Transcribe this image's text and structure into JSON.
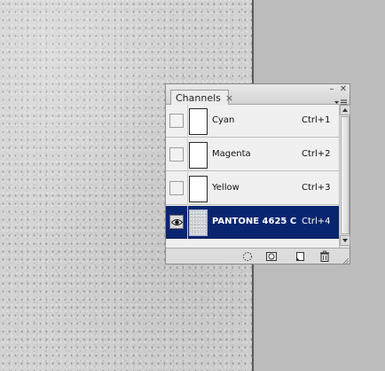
{
  "panel": {
    "tab_label": "Channels",
    "tab_close_glyph": "×",
    "minimize_glyph": "–",
    "close_glyph": "✕"
  },
  "channels": [
    {
      "name": "Cyan",
      "shortcut": "Ctrl+1",
      "visible": false,
      "selected": false
    },
    {
      "name": "Magenta",
      "shortcut": "Ctrl+2",
      "visible": false,
      "selected": false
    },
    {
      "name": "Yellow",
      "shortcut": "Ctrl+3",
      "visible": false,
      "selected": false
    },
    {
      "name": "PANTONE 4625 C",
      "shortcut": "Ctrl+4",
      "visible": true,
      "selected": true
    }
  ],
  "footer_icons": [
    "load-selection-icon",
    "save-selection-icon",
    "new-channel-icon",
    "delete-channel-icon"
  ],
  "colors": {
    "selection": "#0a2570",
    "panel_bg": "#d6d6d6",
    "app_bg": "#bcbcbc"
  }
}
